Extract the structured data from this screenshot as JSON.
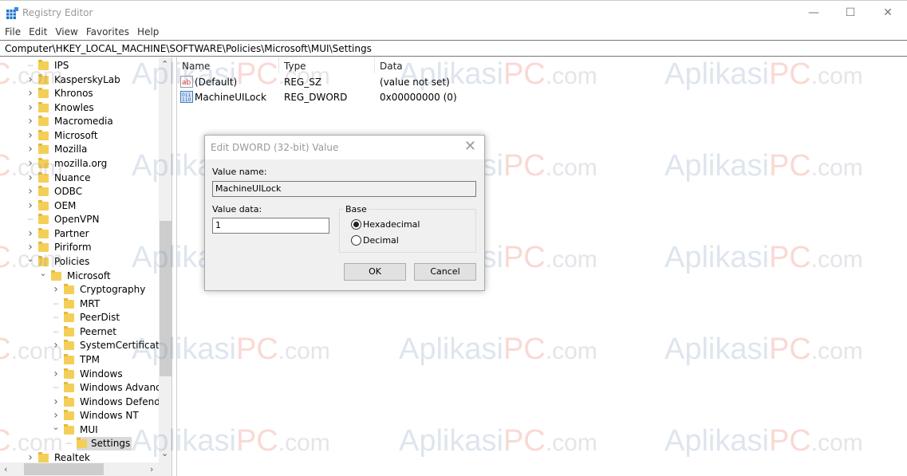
{
  "window": {
    "title": "Registry Editor",
    "minimize": "—",
    "maximize": "☐",
    "close": "✕"
  },
  "menu": [
    "File",
    "Edit",
    "View",
    "Favorites",
    "Help"
  ],
  "address": "Computer\\HKEY_LOCAL_MACHINE\\SOFTWARE\\Policies\\Microsoft\\MUI\\Settings",
  "tree": [
    {
      "label": "IPS",
      "level": 0,
      "state": "leaf"
    },
    {
      "label": "KasperskyLab",
      "level": 0,
      "state": "collapsed"
    },
    {
      "label": "Khronos",
      "level": 0,
      "state": "collapsed"
    },
    {
      "label": "Knowles",
      "level": 0,
      "state": "collapsed"
    },
    {
      "label": "Macromedia",
      "level": 0,
      "state": "collapsed"
    },
    {
      "label": "Microsoft",
      "level": 0,
      "state": "collapsed"
    },
    {
      "label": "Mozilla",
      "level": 0,
      "state": "collapsed"
    },
    {
      "label": "mozilla.org",
      "level": 0,
      "state": "collapsed"
    },
    {
      "label": "Nuance",
      "level": 0,
      "state": "collapsed"
    },
    {
      "label": "ODBC",
      "level": 0,
      "state": "collapsed"
    },
    {
      "label": "OEM",
      "level": 0,
      "state": "collapsed"
    },
    {
      "label": "OpenVPN",
      "level": 0,
      "state": "leaf"
    },
    {
      "label": "Partner",
      "level": 0,
      "state": "collapsed"
    },
    {
      "label": "Piriform",
      "level": 0,
      "state": "collapsed"
    },
    {
      "label": "Policies",
      "level": 0,
      "state": "expanded"
    },
    {
      "label": "Microsoft",
      "level": 1,
      "state": "expanded"
    },
    {
      "label": "Cryptography",
      "level": 2,
      "state": "collapsed"
    },
    {
      "label": "MRT",
      "level": 2,
      "state": "leaf"
    },
    {
      "label": "PeerDist",
      "level": 2,
      "state": "leaf"
    },
    {
      "label": "Peernet",
      "level": 2,
      "state": "leaf"
    },
    {
      "label": "SystemCertificates",
      "level": 2,
      "state": "collapsed"
    },
    {
      "label": "TPM",
      "level": 2,
      "state": "leaf"
    },
    {
      "label": "Windows",
      "level": 2,
      "state": "collapsed"
    },
    {
      "label": "Windows Advanced",
      "level": 2,
      "state": "leaf"
    },
    {
      "label": "Windows Defender",
      "level": 2,
      "state": "collapsed"
    },
    {
      "label": "Windows NT",
      "level": 2,
      "state": "collapsed"
    },
    {
      "label": "MUI",
      "level": 2,
      "state": "expanded"
    },
    {
      "label": "Settings",
      "level": 3,
      "state": "leaf",
      "selected": true
    },
    {
      "label": "Realtek",
      "level": 0,
      "state": "collapsed"
    }
  ],
  "list": {
    "columns": [
      "Name",
      "Type",
      "Data"
    ],
    "rows": [
      {
        "icon": "string-value-icon",
        "name": "(Default)",
        "type": "REG_SZ",
        "data": "(value not set)"
      },
      {
        "icon": "binary-value-icon",
        "name": "MachineUILock",
        "type": "REG_DWORD",
        "data": "0x00000000 (0)"
      }
    ]
  },
  "dialog": {
    "title": "Edit DWORD (32-bit) Value",
    "value_name_label": "Value name:",
    "value_name": "MachineUILock",
    "value_data_label": "Value data:",
    "value_data": "1",
    "base_label": "Base",
    "hex_label": "Hexadecimal",
    "dec_label": "Decimal",
    "base_selected": "Hexadecimal",
    "ok": "OK",
    "cancel": "Cancel"
  },
  "watermark": {
    "part1": "Aplikasi",
    "part2": "PC",
    "part3": ".com"
  },
  "colors": {
    "folder": "#f4cf58",
    "selection": "#d9d9d9",
    "watermark_red": "#e8573f",
    "watermark_blue": "#6b8db5"
  }
}
